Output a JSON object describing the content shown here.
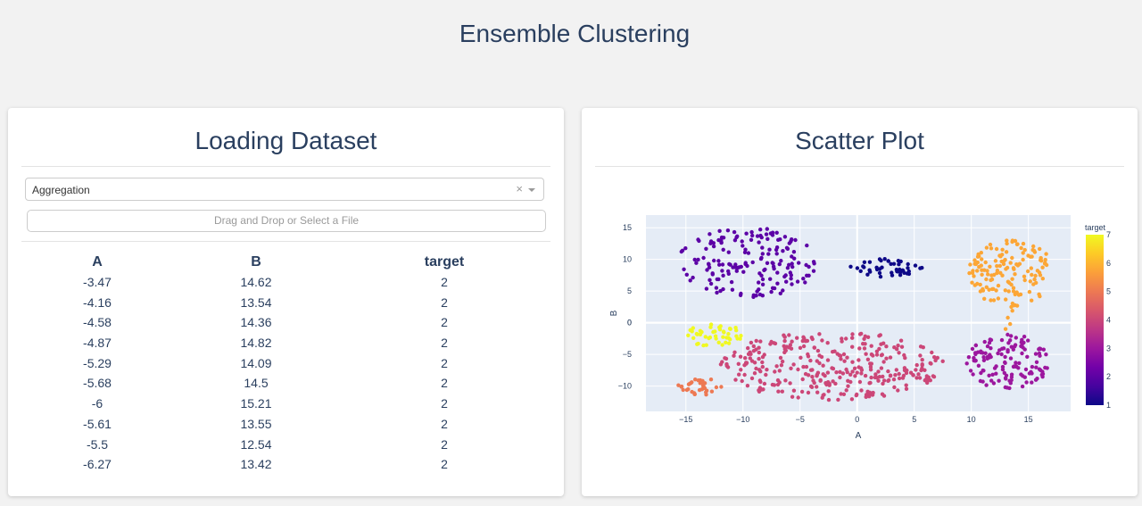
{
  "app_title": "Ensemble Clustering",
  "left_panel": {
    "title": "Loading Dataset",
    "dropdown_value": "Aggregation",
    "clear_icon": "×",
    "upload_text": "Drag and Drop or Select a File",
    "columns": [
      "A",
      "B",
      "target"
    ],
    "rows": [
      [
        "-3.47",
        "14.62",
        "2"
      ],
      [
        "-4.16",
        "13.54",
        "2"
      ],
      [
        "-4.58",
        "14.36",
        "2"
      ],
      [
        "-4.87",
        "14.82",
        "2"
      ],
      [
        "-5.29",
        "14.09",
        "2"
      ],
      [
        "-5.68",
        "14.5",
        "2"
      ],
      [
        "-6",
        "15.21",
        "2"
      ],
      [
        "-5.61",
        "13.55",
        "2"
      ],
      [
        "-5.5",
        "12.54",
        "2"
      ],
      [
        "-6.27",
        "13.42",
        "2"
      ]
    ]
  },
  "right_panel": {
    "title": "Scatter Plot"
  },
  "chart_data": {
    "type": "scatter",
    "xlabel": "A",
    "ylabel": "B",
    "xlim": [
      -18.5,
      18.7
    ],
    "ylim": [
      -14,
      17
    ],
    "x_ticks": [
      -15,
      -10,
      -5,
      0,
      5,
      10,
      15
    ],
    "y_ticks": [
      -10,
      -5,
      0,
      5,
      10,
      15
    ],
    "x_tick_labels": [
      "−15",
      "−10",
      "−5",
      "0",
      "5",
      "10",
      "15"
    ],
    "y_tick_labels": [
      "−10",
      "−5",
      "0",
      "5",
      "10",
      "15"
    ],
    "grid": true,
    "colorbar": {
      "title": "target",
      "range": [
        1,
        7
      ],
      "ticks": [
        1,
        2,
        3,
        4,
        5,
        6,
        7
      ],
      "colors": [
        "#0d0887",
        "#46039f",
        "#7201a8",
        "#9c179e",
        "#bd3786",
        "#d8576b",
        "#ed7953",
        "#fb9f3a",
        "#fdca26",
        "#f0f921"
      ]
    },
    "clusters": [
      {
        "target": 1,
        "color": "#0d0887",
        "center": [
          2.5,
          8.7
        ],
        "spread": [
          3.2,
          1.5
        ],
        "count": 45
      },
      {
        "target": 2,
        "color": "#5c01a6",
        "center": [
          -9.5,
          9.5
        ],
        "spread": [
          6.2,
          5.5
        ],
        "count": 170
      },
      {
        "target": 3,
        "color": "#9c179e",
        "center": [
          13.2,
          -6.2
        ],
        "spread": [
          3.6,
          4.4
        ],
        "count": 130
      },
      {
        "target": 4,
        "color": "#cc4778",
        "center": [
          -2.2,
          -6.8
        ],
        "spread": [
          9.8,
          5.4
        ],
        "count": 320
      },
      {
        "target": 5,
        "color": "#ed7953",
        "center": [
          -13.7,
          -10.1
        ],
        "spread": [
          2.0,
          1.3
        ],
        "count": 34
      },
      {
        "target": 6,
        "color": "#fca636",
        "center": [
          13.5,
          7.8
        ],
        "spread": [
          3.8,
          5.2
        ],
        "count": 140
      },
      {
        "target": 7,
        "color": "#f0f921",
        "center": [
          -12.6,
          -1.9
        ],
        "spread": [
          2.6,
          1.8
        ],
        "count": 45
      }
    ],
    "bridge": {
      "target": 6,
      "color": "#fca636",
      "x": [
        13.6,
        13.2,
        13.4,
        13.0,
        13.5
      ],
      "y": [
        1.9,
        0.8,
        -0.2,
        -1.0,
        2.5
      ]
    }
  }
}
